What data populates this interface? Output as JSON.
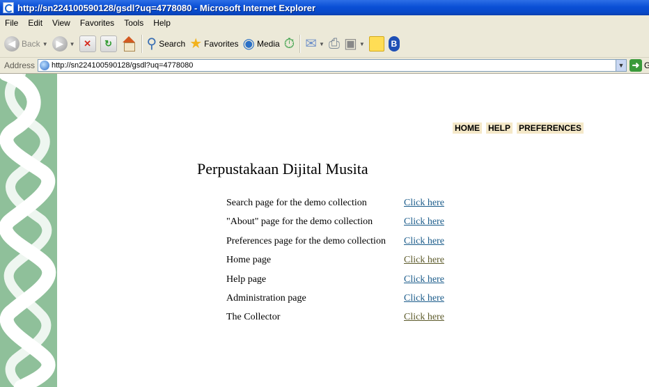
{
  "window": {
    "title": "http://sn224100590128/gsdl?uq=4778080 - Microsoft Internet Explorer"
  },
  "menu": [
    "File",
    "Edit",
    "View",
    "Favorites",
    "Tools",
    "Help"
  ],
  "toolbar": {
    "back_label": "Back",
    "search_label": "Search",
    "favorites_label": "Favorites",
    "media_label": "Media"
  },
  "address": {
    "label": "Address",
    "url": "http://sn224100590128/gsdl?uq=4778080",
    "go_label": "G"
  },
  "page": {
    "nav": [
      "HOME",
      "HELP",
      "PREFERENCES"
    ],
    "title": "Perpustakaan Dijital Musita",
    "links": [
      {
        "description": "Search page for the demo collection",
        "link_text": "Click here",
        "visited": false
      },
      {
        "description": "\"About\" page for the demo collection",
        "link_text": "Click here",
        "visited": false
      },
      {
        "description": "Preferences page for the demo collection",
        "link_text": "Click here",
        "visited": false
      },
      {
        "description": "Home page",
        "link_text": "Click here",
        "visited": true
      },
      {
        "description": "Help page",
        "link_text": "Click here",
        "visited": false
      },
      {
        "description": "Administration page",
        "link_text": "Click here",
        "visited": false
      },
      {
        "description": "The Collector",
        "link_text": "Click here",
        "visited": true
      }
    ]
  },
  "colors": {
    "titlebar": "#0a4fd6",
    "chrome": "#ece9d8",
    "border_strip": "#8fc09a",
    "nav_bg": "#f4e8c8",
    "link": "#1a5b8a",
    "visited_link": "#5c5a2a"
  }
}
